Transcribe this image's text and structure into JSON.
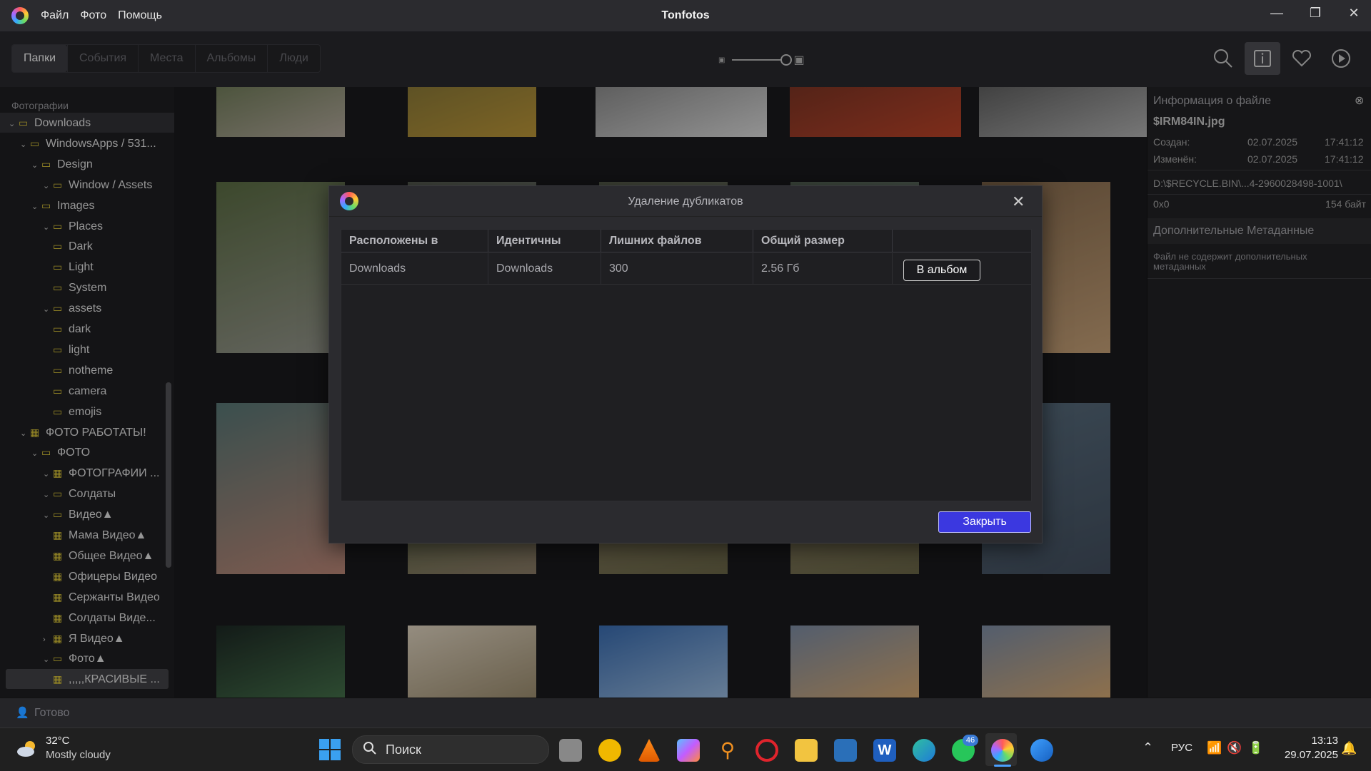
{
  "app": {
    "title": "Tonfotos",
    "menu": [
      "Файл",
      "Фото",
      "Помощь"
    ]
  },
  "tabs": [
    "Папки",
    "События",
    "Места",
    "Альбомы",
    "Люди"
  ],
  "sidebar": {
    "header": "Фотографии",
    "items": [
      {
        "label": "Downloads",
        "depth": 0,
        "chev": "v",
        "icon": "folder",
        "state": "sel"
      },
      {
        "label": "WindowsApps / 531...",
        "depth": 1,
        "chev": "v",
        "icon": "folder"
      },
      {
        "label": "Design",
        "depth": 2,
        "chev": "v",
        "icon": "folder"
      },
      {
        "label": "Window / Assets",
        "depth": 3,
        "chev": "v",
        "icon": "folder"
      },
      {
        "label": "Images",
        "depth": 2,
        "chev": "v",
        "icon": "folder"
      },
      {
        "label": "Places",
        "depth": 3,
        "chev": "v",
        "icon": "folder"
      },
      {
        "label": "Dark",
        "depth": 3,
        "chev": "",
        "icon": "folder"
      },
      {
        "label": "Light",
        "depth": 3,
        "chev": "",
        "icon": "folder"
      },
      {
        "label": "System",
        "depth": 3,
        "chev": "",
        "icon": "folder"
      },
      {
        "label": "assets",
        "depth": 3,
        "chev": "v",
        "icon": "folder"
      },
      {
        "label": "dark",
        "depth": 3,
        "chev": "",
        "icon": "folder"
      },
      {
        "label": "light",
        "depth": 3,
        "chev": "",
        "icon": "folder"
      },
      {
        "label": "notheme",
        "depth": 3,
        "chev": "",
        "icon": "folder"
      },
      {
        "label": "camera",
        "depth": 3,
        "chev": "",
        "icon": "folder"
      },
      {
        "label": "emojis",
        "depth": 3,
        "chev": "",
        "icon": "folder"
      },
      {
        "label": "ФОТО РАБОТАТЫ!",
        "depth": 1,
        "chev": "v",
        "icon": "grid"
      },
      {
        "label": "ФОТО",
        "depth": 2,
        "chev": "v",
        "icon": "folder"
      },
      {
        "label": "ФОТОГРАФИИ ...",
        "depth": 3,
        "chev": "v",
        "icon": "grid"
      },
      {
        "label": "Солдаты",
        "depth": 3,
        "chev": "v",
        "icon": "folder"
      },
      {
        "label": "Видео▲",
        "depth": 3,
        "chev": "v",
        "icon": "folder"
      },
      {
        "label": "Мама Видео▲",
        "depth": 3,
        "chev": "",
        "icon": "grid"
      },
      {
        "label": "Общее Видео▲",
        "depth": 3,
        "chev": "",
        "icon": "grid"
      },
      {
        "label": "Офицеры Видео",
        "depth": 3,
        "chev": "",
        "icon": "grid"
      },
      {
        "label": "Сержанты Видео",
        "depth": 3,
        "chev": "",
        "icon": "grid"
      },
      {
        "label": "Солдаты Виде...",
        "depth": 3,
        "chev": "",
        "icon": "grid"
      },
      {
        "label": "Я Видео▲",
        "depth": 3,
        "chev": ">",
        "icon": "grid"
      },
      {
        "label": "Фото▲",
        "depth": 3,
        "chev": "v",
        "icon": "folder"
      },
      {
        "label": ",,,,,КРАСИВЫЕ ...",
        "depth": 3,
        "chev": "",
        "icon": "grid",
        "state": "sel2"
      }
    ]
  },
  "info": {
    "header": "Информация о файле",
    "filename": "$IRM84IN.jpg",
    "created_label": "Создан:",
    "created_date": "02.07.2025",
    "created_time": "17:41:12",
    "modified_label": "Изменён:",
    "modified_date": "02.07.2025",
    "modified_time": "17:41:12",
    "path": "D:\\$RECYCLE.BIN\\...4-2960028498-1001\\",
    "dims": "0x0",
    "size": "154 байт",
    "meta_header": "Дополнительные Метаданные",
    "meta_text": "Файл не содержит дополнительных метаданных"
  },
  "status": {
    "text": "Готово"
  },
  "dialog": {
    "title": "Удаление дубликатов",
    "columns": [
      "Расположены в",
      "Идентичны",
      "Лишних файлов",
      "Общий размер",
      ""
    ],
    "row": [
      "Downloads",
      "Downloads",
      "300",
      "2.56 Гб"
    ],
    "album_button": "В альбом",
    "close_button": "Закрыть"
  },
  "taskbar": {
    "temp": "32°C",
    "weather": "Mostly cloudy",
    "search_placeholder": "Поиск",
    "badge": "46",
    "lang": "РУС",
    "time": "13:13",
    "date": "29.07.2025"
  },
  "colors": {
    "accent": "#3b38e0",
    "folder": "#e8d13a",
    "bg": "#1b1b1e"
  },
  "thumbnails": [
    {
      "name": "garden-photo",
      "c1": "#6d7b55",
      "c2": "#b7ada0"
    },
    {
      "name": "flowers-photo",
      "c1": "#8a7a3a",
      "c2": "#c09a3a"
    },
    {
      "name": "car-photo",
      "c1": "#888",
      "c2": "#e0e0e0"
    },
    {
      "name": "red-car-photo",
      "c1": "#7a3525",
      "c2": "#c0452a"
    },
    {
      "name": "parking-photo",
      "c1": "#5a5a5a",
      "c2": "#b7b7b7"
    },
    {
      "name": "park-alley-photo",
      "c1": "#5d6f45",
      "c2": "#999a90"
    },
    {
      "name": "photo-2",
      "c1": "#60665a",
      "c2": "#9aa0a0"
    },
    {
      "name": "photo-3",
      "c1": "#5f6552",
      "c2": "#90968c"
    },
    {
      "name": "photo-4",
      "c1": "#5a6a5a",
      "c2": "#8a9a9a"
    },
    {
      "name": "snake-photo",
      "c1": "#8a6e50",
      "c2": "#caa47a"
    },
    {
      "name": "terrarium-photo",
      "c1": "#5b7a78",
      "c2": "#c08a7a"
    },
    {
      "name": "tree-photo",
      "c1": "#4e6a3a",
      "c2": "#8f7f6a"
    },
    {
      "name": "paving-photo",
      "c1": "#9a8a70",
      "c2": "#6e6a4a"
    },
    {
      "name": "paving-photo-2",
      "c1": "#9a8a70",
      "c2": "#6e6a4a"
    },
    {
      "name": "glass-photo",
      "c1": "#5a6f80",
      "c2": "#445060"
    },
    {
      "name": "bar-photo",
      "c1": "#1e2a25",
      "c2": "#4a7a50"
    },
    {
      "name": "room-photo",
      "c1": "#e4d8c4",
      "c2": "#9a8a6a"
    },
    {
      "name": "sky-tree-photo",
      "c1": "#3b6fb5",
      "c2": "#a8c8ea"
    },
    {
      "name": "sunset-photo",
      "c1": "#8090a8",
      "c2": "#e4b070"
    },
    {
      "name": "sunset-photo-2",
      "c1": "#8090a8",
      "c2": "#e4b070"
    }
  ]
}
